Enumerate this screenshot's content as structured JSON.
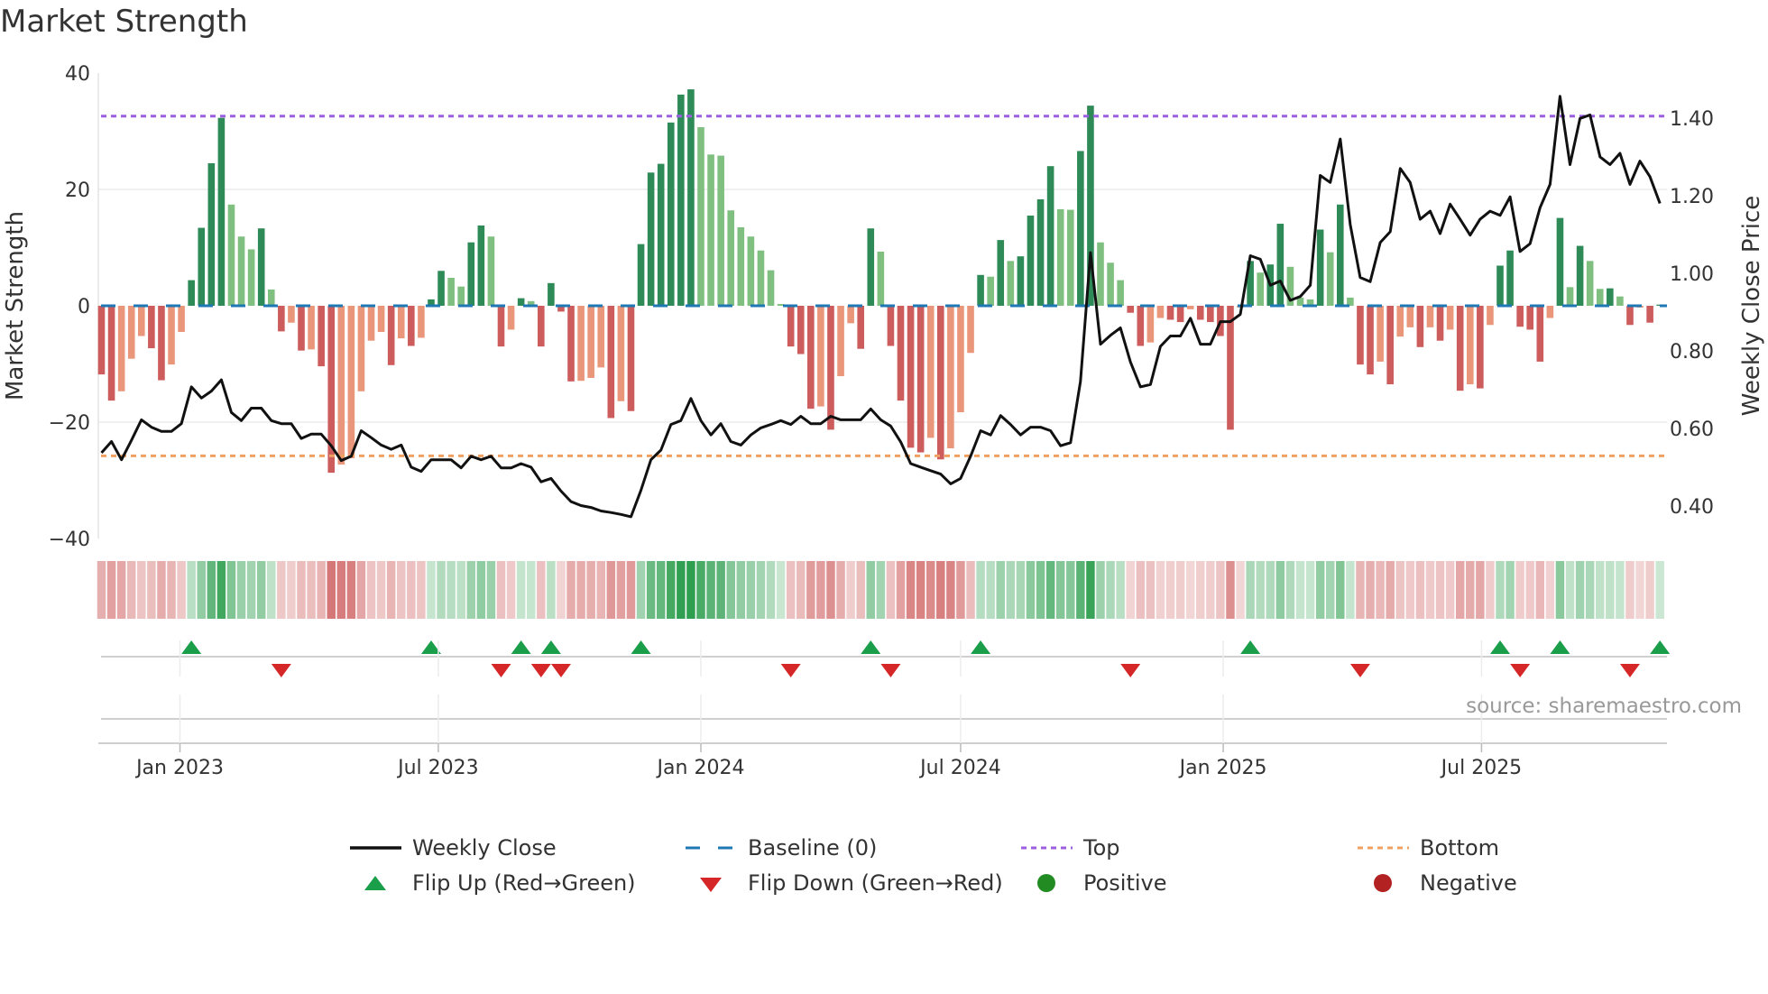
{
  "title": "Market Strength",
  "source": "source: sharemaestro.com",
  "legend": {
    "weekly_close": "Weekly Close",
    "baseline": "Baseline (0)",
    "top": "Top",
    "bottom": "Bottom",
    "flip_up": "Flip Up (Red→Green)",
    "flip_down": "Flip Down (Green→Red)",
    "positive": "Positive",
    "negative": "Negative"
  },
  "colors": {
    "green_rising": "#2e8b57",
    "green_falling": "#7fbf7f",
    "red_rising": "#cd5c5c",
    "red_falling": "#e9967a",
    "close_line": "#111111",
    "baseline": "#1f77b4",
    "top": "#9b5fe0",
    "bottom": "#f0a060",
    "flip_up": "#1a9e4a",
    "flip_down": "#d62728",
    "positive": "#228b22",
    "negative": "#b22222",
    "strip_green": "#2e9e4f",
    "strip_red": "#cd5c5c"
  },
  "chart_data": {
    "type": "bar+line",
    "frequency": "weekly",
    "start_week": "2022-11-07",
    "title": "Market Strength",
    "left_axis": {
      "label": "Market Strength",
      "ylim": [
        -40,
        40
      ],
      "ticks": [
        40,
        20,
        0,
        -20,
        -40
      ],
      "tick_labels": [
        "40",
        "20",
        "0",
        "−20",
        "−40"
      ]
    },
    "right_axis": {
      "label": "Weekly Close Price",
      "ylim": [
        0.316,
        1.516
      ],
      "ticks": [
        1.4,
        1.2,
        1.0,
        0.8,
        0.6,
        0.4
      ],
      "tick_labels": [
        "1.40",
        "1.20",
        "1.00",
        "0.80",
        "0.60",
        "0.40"
      ]
    },
    "top_level": 32.6,
    "bottom_level": -25.8,
    "baseline": 0,
    "x_ticks": [
      {
        "date": "2023-01-01",
        "label": "Jan 2023"
      },
      {
        "date": "2023-07-01",
        "label": "Jul 2023"
      },
      {
        "date": "2024-01-01",
        "label": "Jan 2024"
      },
      {
        "date": "2024-07-01",
        "label": "Jul 2024"
      },
      {
        "date": "2025-01-01",
        "label": "Jan 2025"
      },
      {
        "date": "2025-07-01",
        "label": "Jul 2025"
      }
    ],
    "strength": [
      -11.8,
      -16.3,
      -14.7,
      -9.1,
      -5.2,
      -7.3,
      -12.8,
      -10.1,
      -4.5,
      4.4,
      13.4,
      24.5,
      32.3,
      17.4,
      11.9,
      9.7,
      13.3,
      2.8,
      -4.4,
      -2.9,
      -7.7,
      -7.5,
      -10.4,
      -28.7,
      -27.3,
      -26.2,
      -14.7,
      -6,
      -4.5,
      -10.2,
      -5.6,
      -6.9,
      -5.5,
      1.1,
      6,
      4.8,
      3.3,
      10.9,
      13.8,
      11.9,
      -7,
      -4.1,
      1.3,
      0.8,
      -7,
      3.9,
      -1,
      -13,
      -12.9,
      -12.4,
      -10.6,
      -19.3,
      -16.4,
      -18.1,
      10.6,
      22.9,
      24.4,
      31.5,
      36.3,
      37.2,
      30.7,
      26,
      25.8,
      16.4,
      13.5,
      11.9,
      9.5,
      6.1,
      0.3,
      -7,
      -8.3,
      -17.7,
      -17.3,
      -21.3,
      -12.1,
      -3,
      -7.4,
      13.3,
      9.3,
      -6.9,
      -16.3,
      -24.4,
      -25.2,
      -22.7,
      -26.4,
      -24.5,
      -18.3,
      -8.1,
      5.3,
      5,
      11.3,
      7.7,
      8.5,
      15.5,
      18.3,
      24,
      16.6,
      16.5,
      26.6,
      34.4,
      10.9,
      7.4,
      4.4,
      -1.2,
      -6.9,
      -6.3,
      -2.1,
      -2.4,
      -2.8,
      -0.6,
      -2.4,
      -2.8,
      -5.2,
      -21.3,
      -0.3,
      7.7,
      5.7,
      7.1,
      14.1,
      6.7,
      1.4,
      1.1,
      13.1,
      9.2,
      17.4,
      1.4,
      -10.1,
      -11.8,
      -9.6,
      -13.5,
      -5.3,
      -3.7,
      -7.1,
      -3.7,
      -6,
      -4.1,
      -14.6,
      -13.5,
      -14.2,
      -3.3,
      6.9,
      9.5,
      -3.6,
      -4.1,
      -9.6,
      -2.1,
      15.1,
      3.2,
      10.3,
      7.7,
      2.9,
      3.0,
      1.6,
      -3.3,
      -0.3,
      -2.9,
      0.2
    ],
    "weekly_close": [
      0.537,
      0.566,
      0.519,
      0.569,
      0.622,
      0.603,
      0.592,
      0.592,
      0.612,
      0.707,
      0.678,
      0.696,
      0.725,
      0.641,
      0.62,
      0.652,
      0.652,
      0.62,
      0.612,
      0.612,
      0.574,
      0.585,
      0.585,
      0.555,
      0.517,
      0.528,
      0.594,
      0.576,
      0.557,
      0.546,
      0.557,
      0.5,
      0.489,
      0.519,
      0.519,
      0.519,
      0.498,
      0.528,
      0.519,
      0.528,
      0.498,
      0.498,
      0.509,
      0.5,
      0.462,
      0.471,
      0.438,
      0.411,
      0.401,
      0.396,
      0.387,
      0.383,
      0.378,
      0.372,
      0.44,
      0.519,
      0.544,
      0.61,
      0.62,
      0.677,
      0.62,
      0.583,
      0.612,
      0.566,
      0.557,
      0.583,
      0.601,
      0.61,
      0.62,
      0.61,
      0.631,
      0.612,
      0.612,
      0.631,
      0.622,
      0.622,
      0.622,
      0.65,
      0.622,
      0.606,
      0.565,
      0.509,
      0.5,
      0.491,
      0.482,
      0.457,
      0.471,
      0.528,
      0.594,
      0.583,
      0.633,
      0.61,
      0.583,
      0.603,
      0.603,
      0.594,
      0.555,
      0.563,
      0.721,
      1.053,
      0.817,
      0.84,
      0.859,
      0.771,
      0.707,
      0.713,
      0.811,
      0.838,
      0.838,
      0.884,
      0.817,
      0.817,
      0.875,
      0.875,
      0.894,
      1.045,
      1.036,
      0.969,
      0.98,
      0.93,
      0.94,
      0.969,
      1.252,
      1.234,
      1.346,
      1.125,
      0.989,
      0.978,
      1.079,
      1.107,
      1.27,
      1.234,
      1.139,
      1.16,
      1.102,
      1.178,
      1.139,
      1.098,
      1.139,
      1.16,
      1.149,
      1.197,
      1.056,
      1.076,
      1.169,
      1.229,
      1.456,
      1.28,
      1.399,
      1.408,
      1.3,
      1.28,
      1.309,
      1.229,
      1.289,
      1.249,
      1.18
    ]
  }
}
